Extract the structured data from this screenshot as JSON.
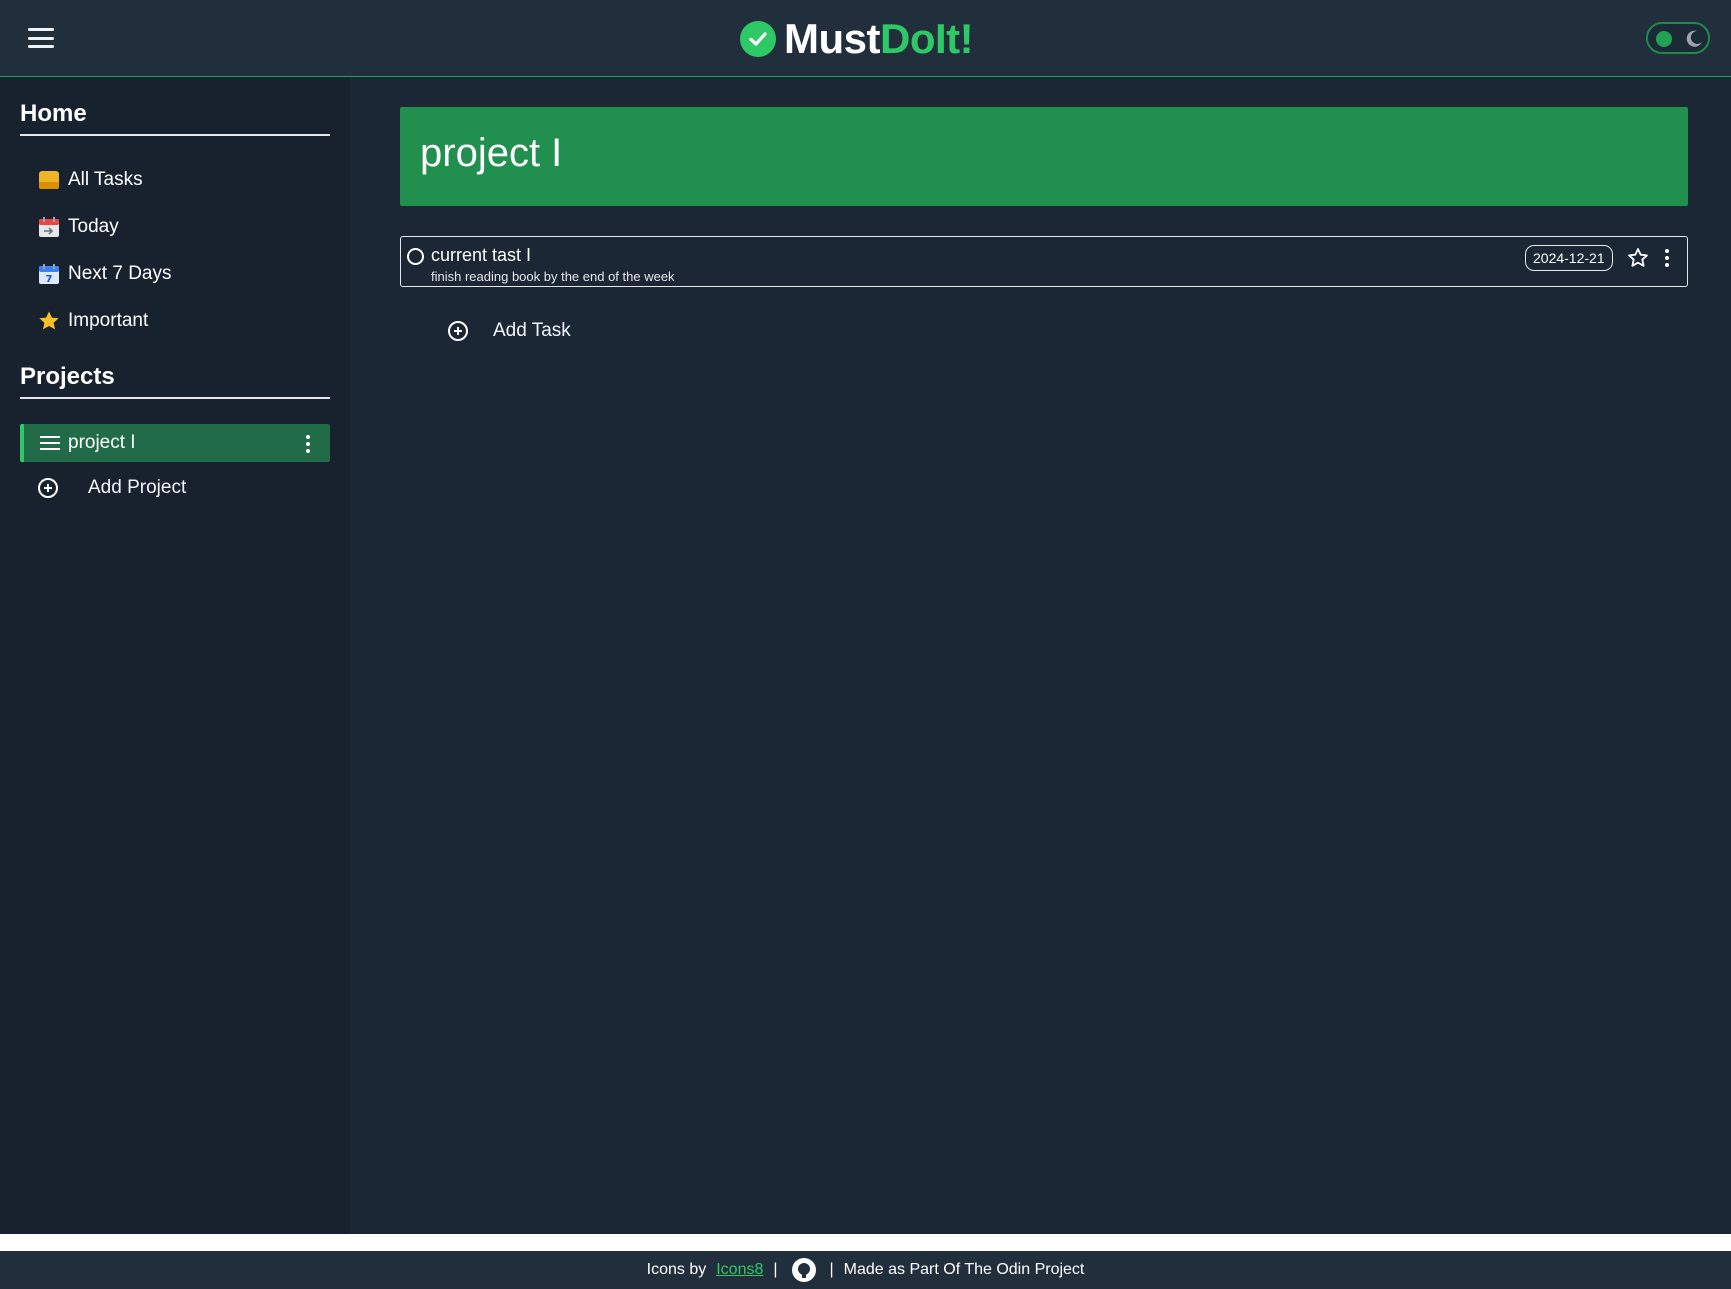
{
  "app": {
    "brand_must": "Must",
    "brand_doit": "DoIt!",
    "accent_color": "#2ec866",
    "icons": [
      "hamburger-icon",
      "check-logo-icon",
      "theme-toggle-icon"
    ]
  },
  "sidebar": {
    "home_title": "Home",
    "home_items": [
      {
        "label": "All Tasks",
        "icon": "inbox-icon"
      },
      {
        "label": "Today",
        "icon": "calendar-today-icon"
      },
      {
        "label": "Next 7 Days",
        "icon": "calendar-7-icon"
      },
      {
        "label": "Important",
        "icon": "star-icon"
      }
    ],
    "projects_title": "Projects",
    "projects": [
      {
        "label": "project I",
        "active": true
      }
    ],
    "add_project_label": "Add Project"
  },
  "main": {
    "project_title": "project I",
    "tasks": [
      {
        "title": "current tast I",
        "description": "finish reading book by the end of the week",
        "due_date": "2024-12-21",
        "important": false,
        "completed": false
      }
    ],
    "add_task_label": "Add Task"
  },
  "footer": {
    "icons_by": "Icons by",
    "icons_link": "Icons8",
    "separator": "|",
    "made_as": "Made as Part Of The Odin Project"
  }
}
